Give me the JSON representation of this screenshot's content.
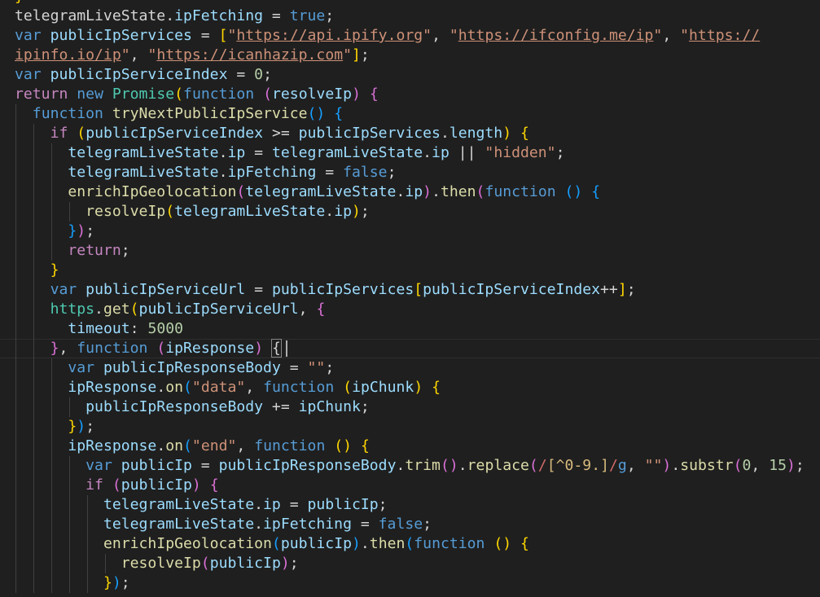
{
  "editor": {
    "theme": "dark",
    "colors": {
      "background": "#1f1f1f",
      "keyword": "#569cd6",
      "control": "#c586c0",
      "variable": "#9cdcfe",
      "function": "#dcdcaa",
      "type": "#4ec9b0",
      "string": "#ce9178",
      "number": "#b5cea8",
      "bracket_level_1": "#ffd700",
      "bracket_level_2": "#da70d6",
      "bracket_level_3": "#179fff"
    },
    "cursor_line_index": 17,
    "lines": [
      [
        [
          "pt",
          "telegramLiveState"
        ],
        [
          "pt",
          "."
        ],
        [
          "vr",
          "ipFetching"
        ],
        [
          "pt",
          " = "
        ],
        [
          "kw",
          "true"
        ],
        [
          "pt",
          ";"
        ]
      ],
      [
        [
          "kw",
          "var"
        ],
        [
          "pt",
          " "
        ],
        [
          "vr",
          "publicIpServices"
        ],
        [
          "pt",
          " = "
        ],
        [
          "b1",
          "["
        ],
        [
          "st",
          "\""
        ],
        [
          "url",
          "https://api.ipify.org"
        ],
        [
          "st",
          "\""
        ],
        [
          "pt",
          ", "
        ],
        [
          "st",
          "\""
        ],
        [
          "url",
          "https://ifconfig.me/ip"
        ],
        [
          "st",
          "\""
        ],
        [
          "pt",
          ", "
        ],
        [
          "st",
          "\""
        ],
        [
          "url",
          "https://"
        ]
      ],
      [
        [
          "url",
          "ipinfo.io/ip"
        ],
        [
          "st",
          "\""
        ],
        [
          "pt",
          ", "
        ],
        [
          "st",
          "\""
        ],
        [
          "url",
          "https://icanhazip.com"
        ],
        [
          "st",
          "\""
        ],
        [
          "b1",
          "]"
        ],
        [
          "pt",
          ";"
        ]
      ],
      [
        [
          "kw",
          "var"
        ],
        [
          "pt",
          " "
        ],
        [
          "vr",
          "publicIpServiceIndex"
        ],
        [
          "pt",
          " = "
        ],
        [
          "nu",
          "0"
        ],
        [
          "pt",
          ";"
        ]
      ],
      [
        [
          "ctl",
          "return"
        ],
        [
          "pt",
          " "
        ],
        [
          "kw",
          "new"
        ],
        [
          "pt",
          " "
        ],
        [
          "ty",
          "Promise"
        ],
        [
          "b1",
          "("
        ],
        [
          "kw",
          "function"
        ],
        [
          "pt",
          " "
        ],
        [
          "b2",
          "("
        ],
        [
          "vr",
          "resolveIp"
        ],
        [
          "b2",
          ")"
        ],
        [
          "pt",
          " "
        ],
        [
          "b2",
          "{"
        ]
      ],
      [
        [
          "pt",
          "  "
        ],
        [
          "kw",
          "function"
        ],
        [
          "pt",
          " "
        ],
        [
          "fn",
          "tryNextPublicIpService"
        ],
        [
          "b3",
          "()"
        ],
        [
          "pt",
          " "
        ],
        [
          "b3",
          "{"
        ]
      ],
      [
        [
          "pt",
          "    "
        ],
        [
          "ctl",
          "if"
        ],
        [
          "pt",
          " "
        ],
        [
          "b1",
          "("
        ],
        [
          "vr",
          "publicIpServiceIndex"
        ],
        [
          "pt",
          " >= "
        ],
        [
          "vr",
          "publicIpServices"
        ],
        [
          "pt",
          "."
        ],
        [
          "vr",
          "length"
        ],
        [
          "b1",
          ")"
        ],
        [
          "pt",
          " "
        ],
        [
          "b1",
          "{"
        ]
      ],
      [
        [
          "pt",
          "      "
        ],
        [
          "vr",
          "telegramLiveState"
        ],
        [
          "pt",
          "."
        ],
        [
          "vr",
          "ip"
        ],
        [
          "pt",
          " = "
        ],
        [
          "vr",
          "telegramLiveState"
        ],
        [
          "pt",
          "."
        ],
        [
          "vr",
          "ip"
        ],
        [
          "pt",
          " || "
        ],
        [
          "st",
          "\"hidden\""
        ],
        [
          "pt",
          ";"
        ]
      ],
      [
        [
          "pt",
          "      "
        ],
        [
          "vr",
          "telegramLiveState"
        ],
        [
          "pt",
          "."
        ],
        [
          "vr",
          "ipFetching"
        ],
        [
          "pt",
          " = "
        ],
        [
          "kw",
          "false"
        ],
        [
          "pt",
          ";"
        ]
      ],
      [
        [
          "pt",
          "      "
        ],
        [
          "fn",
          "enrichIpGeolocation"
        ],
        [
          "b2",
          "("
        ],
        [
          "vr",
          "telegramLiveState"
        ],
        [
          "pt",
          "."
        ],
        [
          "vr",
          "ip"
        ],
        [
          "b2",
          ")"
        ],
        [
          "pt",
          "."
        ],
        [
          "fn",
          "then"
        ],
        [
          "b2",
          "("
        ],
        [
          "kw",
          "function"
        ],
        [
          "pt",
          " "
        ],
        [
          "b3",
          "()"
        ],
        [
          "pt",
          " "
        ],
        [
          "b3",
          "{"
        ]
      ],
      [
        [
          "pt",
          "        "
        ],
        [
          "fn",
          "resolveIp"
        ],
        [
          "b1",
          "("
        ],
        [
          "vr",
          "telegramLiveState"
        ],
        [
          "pt",
          "."
        ],
        [
          "vr",
          "ip"
        ],
        [
          "b1",
          ")"
        ],
        [
          "pt",
          ";"
        ]
      ],
      [
        [
          "pt",
          "      "
        ],
        [
          "b3",
          "}"
        ],
        [
          "b2",
          ")"
        ],
        [
          "pt",
          ";"
        ]
      ],
      [
        [
          "pt",
          "      "
        ],
        [
          "ctl",
          "return"
        ],
        [
          "pt",
          ";"
        ]
      ],
      [
        [
          "pt",
          "    "
        ],
        [
          "b1",
          "}"
        ]
      ],
      [
        [
          "pt",
          "    "
        ],
        [
          "kw",
          "var"
        ],
        [
          "pt",
          " "
        ],
        [
          "vr",
          "publicIpServiceUrl"
        ],
        [
          "pt",
          " = "
        ],
        [
          "vr",
          "publicIpServices"
        ],
        [
          "b1",
          "["
        ],
        [
          "vr",
          "publicIpServiceIndex"
        ],
        [
          "pt",
          "++"
        ],
        [
          "b1",
          "]"
        ],
        [
          "pt",
          ";"
        ]
      ],
      [
        [
          "pt",
          "    "
        ],
        [
          "ty",
          "https"
        ],
        [
          "pt",
          "."
        ],
        [
          "fn",
          "get"
        ],
        [
          "b1",
          "("
        ],
        [
          "vr",
          "publicIpServiceUrl"
        ],
        [
          "pt",
          ", "
        ],
        [
          "b2",
          "{"
        ]
      ],
      [
        [
          "pt",
          "      "
        ],
        [
          "vr",
          "timeout"
        ],
        [
          "pt",
          ": "
        ],
        [
          "nu",
          "5000"
        ]
      ],
      [
        [
          "pt",
          "    "
        ],
        [
          "b2",
          "}"
        ],
        [
          "pt",
          ", "
        ],
        [
          "kw",
          "function"
        ],
        [
          "pt",
          " "
        ],
        [
          "b2",
          "("
        ],
        [
          "vr",
          "ipResponse"
        ],
        [
          "b2",
          ")"
        ],
        [
          "pt",
          " "
        ],
        [
          "bm",
          "{"
        ]
      ],
      [
        [
          "pt",
          "      "
        ],
        [
          "kw",
          "var"
        ],
        [
          "pt",
          " "
        ],
        [
          "vr",
          "publicIpResponseBody"
        ],
        [
          "pt",
          " = "
        ],
        [
          "st",
          "\"\""
        ],
        [
          "pt",
          ";"
        ]
      ],
      [
        [
          "pt",
          "      "
        ],
        [
          "vr",
          "ipResponse"
        ],
        [
          "pt",
          "."
        ],
        [
          "fn",
          "on"
        ],
        [
          "b3",
          "("
        ],
        [
          "st",
          "\"data\""
        ],
        [
          "pt",
          ", "
        ],
        [
          "kw",
          "function"
        ],
        [
          "pt",
          " "
        ],
        [
          "b1",
          "("
        ],
        [
          "vr",
          "ipChunk"
        ],
        [
          "b1",
          ")"
        ],
        [
          "pt",
          " "
        ],
        [
          "b1",
          "{"
        ]
      ],
      [
        [
          "pt",
          "        "
        ],
        [
          "vr",
          "publicIpResponseBody"
        ],
        [
          "pt",
          " += "
        ],
        [
          "vr",
          "ipChunk"
        ],
        [
          "pt",
          ";"
        ]
      ],
      [
        [
          "pt",
          "      "
        ],
        [
          "b1",
          "}"
        ],
        [
          "b3",
          ")"
        ],
        [
          "pt",
          ";"
        ]
      ],
      [
        [
          "pt",
          "      "
        ],
        [
          "vr",
          "ipResponse"
        ],
        [
          "pt",
          "."
        ],
        [
          "fn",
          "on"
        ],
        [
          "b3",
          "("
        ],
        [
          "st",
          "\"end\""
        ],
        [
          "pt",
          ", "
        ],
        [
          "kw",
          "function"
        ],
        [
          "pt",
          " "
        ],
        [
          "b1",
          "()"
        ],
        [
          "pt",
          " "
        ],
        [
          "b1",
          "{"
        ]
      ],
      [
        [
          "pt",
          "        "
        ],
        [
          "kw",
          "var"
        ],
        [
          "pt",
          " "
        ],
        [
          "vr",
          "publicIp"
        ],
        [
          "pt",
          " = "
        ],
        [
          "vr",
          "publicIpResponseBody"
        ],
        [
          "pt",
          "."
        ],
        [
          "fn",
          "trim"
        ],
        [
          "b2",
          "()"
        ],
        [
          "pt",
          "."
        ],
        [
          "fn",
          "replace"
        ],
        [
          "b2",
          "("
        ],
        [
          "rx",
          "/"
        ],
        [
          "re",
          "[^0-9.]"
        ],
        [
          "rx",
          "/"
        ],
        [
          "kw",
          "g"
        ],
        [
          "pt",
          ", "
        ],
        [
          "st",
          "\"\""
        ],
        [
          "b2",
          ")"
        ],
        [
          "pt",
          "."
        ],
        [
          "fn",
          "substr"
        ],
        [
          "b2",
          "("
        ],
        [
          "nu",
          "0"
        ],
        [
          "pt",
          ", "
        ],
        [
          "nu",
          "15"
        ],
        [
          "b2",
          ")"
        ],
        [
          "pt",
          ";"
        ]
      ],
      [
        [
          "pt",
          "        "
        ],
        [
          "ctl",
          "if"
        ],
        [
          "pt",
          " "
        ],
        [
          "b2",
          "("
        ],
        [
          "vr",
          "publicIp"
        ],
        [
          "b2",
          ")"
        ],
        [
          "pt",
          " "
        ],
        [
          "b2",
          "{"
        ]
      ],
      [
        [
          "pt",
          "          "
        ],
        [
          "vr",
          "telegramLiveState"
        ],
        [
          "pt",
          "."
        ],
        [
          "vr",
          "ip"
        ],
        [
          "pt",
          " = "
        ],
        [
          "vr",
          "publicIp"
        ],
        [
          "pt",
          ";"
        ]
      ],
      [
        [
          "pt",
          "          "
        ],
        [
          "vr",
          "telegramLiveState"
        ],
        [
          "pt",
          "."
        ],
        [
          "vr",
          "ipFetching"
        ],
        [
          "pt",
          " = "
        ],
        [
          "kw",
          "false"
        ],
        [
          "pt",
          ";"
        ]
      ],
      [
        [
          "pt",
          "          "
        ],
        [
          "fn",
          "enrichIpGeolocation"
        ],
        [
          "b3",
          "("
        ],
        [
          "vr",
          "publicIp"
        ],
        [
          "b3",
          ")"
        ],
        [
          "pt",
          "."
        ],
        [
          "fn",
          "then"
        ],
        [
          "b3",
          "("
        ],
        [
          "kw",
          "function"
        ],
        [
          "pt",
          " "
        ],
        [
          "b1",
          "()"
        ],
        [
          "pt",
          " "
        ],
        [
          "b1",
          "{"
        ]
      ],
      [
        [
          "pt",
          "            "
        ],
        [
          "fn",
          "resolveIp"
        ],
        [
          "b2",
          "("
        ],
        [
          "vr",
          "publicIp"
        ],
        [
          "b2",
          ")"
        ],
        [
          "pt",
          ";"
        ]
      ],
      [
        [
          "pt",
          "          "
        ],
        [
          "b1",
          "}"
        ],
        [
          "b3",
          ")"
        ],
        [
          "pt",
          ";"
        ]
      ]
    ]
  }
}
